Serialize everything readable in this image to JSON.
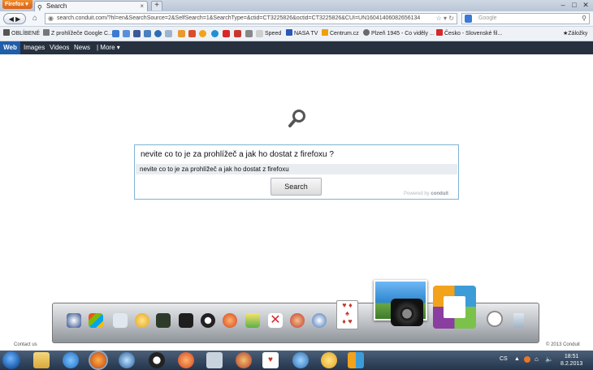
{
  "browser": {
    "menu_button": "Firefox",
    "tab_title": "Search",
    "url": "search.conduit.com/?hl=en&SearchSource=2&SelfSearch=1&SearchType=&ctid=CT3225826&octid=CT3225826&CUI=UN16041406082656134",
    "search_engine_placeholder": "Google"
  },
  "bookmarks": {
    "items": [
      "OBLÍBENÉ",
      "Z prohlížeče Google C...",
      "Speed",
      "NASA TV",
      "Centrum.cz",
      "Plzeň 1945 - Co viděly ...",
      "Česko - Slovenské fil..."
    ],
    "right_label": "Záložky"
  },
  "search_nav": {
    "items": [
      "Web",
      "Images",
      "Videos",
      "News"
    ],
    "more": "| More"
  },
  "search": {
    "query": "nevite co to je za prohlížeč a jak ho dostat z firefoxu ?",
    "suggestion": "nevite co to je za prohlížeč a jak ho dostat z firefoxu",
    "button_label": "Search",
    "powered_prefix": "Powered by",
    "powered_brand": "conduit"
  },
  "footer": {
    "contact": "Contact us",
    "copyright": "© 2013 Conduit"
  },
  "taskbar": {
    "language": "CS",
    "time": "18:51",
    "date": "8.2.2013"
  },
  "colors": {
    "accent": "#1f5ea8",
    "nav_background": "#26303e",
    "search_border": "#7fb2d6",
    "taskbar": "#24354b"
  }
}
